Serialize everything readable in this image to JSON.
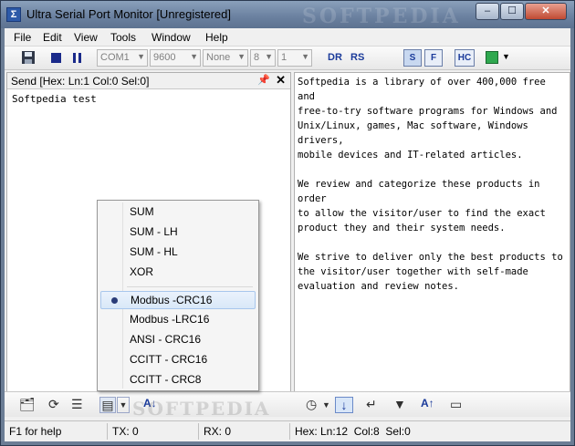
{
  "window": {
    "title": "Ultra Serial Port Monitor [Unregistered]",
    "minimize": "–",
    "maximize": "☐",
    "close": "✕",
    "watermark": "SOFTPEDIA"
  },
  "menubar": [
    "File",
    "Edit",
    "View",
    "Tools",
    "Window",
    "Help"
  ],
  "toolbar": {
    "port": "COM1",
    "baud": "9600",
    "parity": "None",
    "databits": "8",
    "stopbits": "1",
    "dr_label": "DR",
    "rs_label": "RS",
    "s_label": "S",
    "f_label": "F",
    "hc_label": "HC",
    "color_swatch": "#2fa84f"
  },
  "send_pane": {
    "header": "Send [Hex: Ln:1 Col:0 Sel:0]",
    "text": "Softpedia test"
  },
  "receive_pane": {
    "text": "Softpedia is a library of over 400,000 free and\nfree-to-try software programs for Windows and\nUnix/Linux, games, Mac software, Windows drivers,\nmobile devices and IT-related articles.\n\nWe review and categorize these products in order\nto allow the visitor/user to find the exact\nproduct they and their system needs.\n\nWe strive to deliver only the best products to\nthe visitor/user together with self-made\nevaluation and review notes."
  },
  "checksum_menu": {
    "group1": [
      "SUM",
      "SUM - LH",
      "SUM - HL",
      "XOR"
    ],
    "group2": [
      "Modbus -CRC16",
      "Modbus -LRC16",
      "ANSI - CRC16",
      "CCITT - CRC16",
      "CCITT - CRC8"
    ],
    "selected_index": 0
  },
  "statusbar": {
    "help": "F1 for help",
    "tx": "TX: 0",
    "rx": "RX: 0",
    "hex": "Hex: Ln:12  Col:8  Sel:0"
  },
  "icons": {
    "save": "save-icon",
    "stop": "stop-icon",
    "pause": "pause-icon"
  }
}
